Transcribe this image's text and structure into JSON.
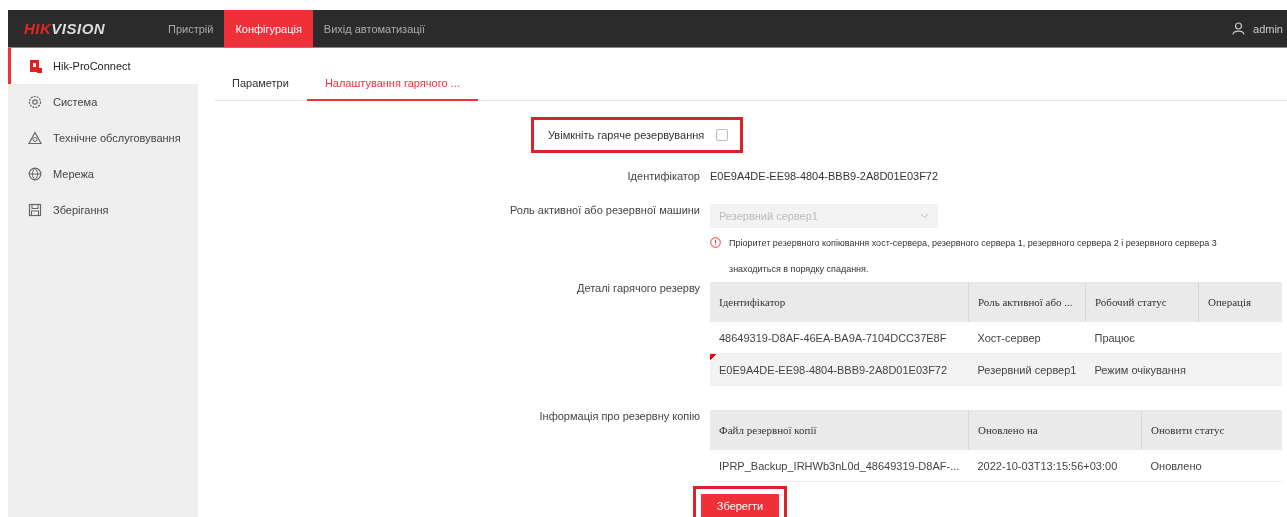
{
  "header": {
    "logo": {
      "red": "HIK",
      "dark": "VISION"
    },
    "nav": [
      {
        "label": "Пристрій",
        "selected": false
      },
      {
        "label": "Конфігурація",
        "selected": true
      },
      {
        "label": "Вихід автоматизації",
        "selected": false
      }
    ],
    "user": "admin"
  },
  "sidebar": {
    "items": [
      {
        "label": "Hik-ProConnect",
        "selected": true
      },
      {
        "label": "Система",
        "selected": false
      },
      {
        "label": "Технічне обслуговування",
        "selected": false
      },
      {
        "label": "Мережа",
        "selected": false
      },
      {
        "label": "Зберігання",
        "selected": false
      }
    ]
  },
  "tabs": [
    {
      "label": "Параметри",
      "selected": false
    },
    {
      "label": "Налаштування гарячого ...",
      "selected": true
    }
  ],
  "form": {
    "hot_standby": {
      "label": "Увімкніть гаряче резервування",
      "checked": false,
      "highlighted": true
    },
    "identifier": {
      "label": "Ідентифікатор",
      "value": "E0E9A4DE-EE98-4804-BBB9-2A8D01E03F72"
    },
    "role": {
      "label": "Роль активної або резервної машини",
      "value": "Резервний сервер1",
      "disabled": true,
      "hint": "Пріоритет резервного копіювання хост-сервера, резервного сервера 1, резервного сервера 2 і резервного сервера 3 знаходиться в порядку спадання."
    },
    "details": {
      "label": "Деталі гарячого резерву",
      "columns": [
        "Ідентифікатор",
        "Роль активної або ...",
        "Робочий статус",
        "Операція"
      ],
      "rows": [
        {
          "cells": [
            "48649319-D8AF-46EA-BA9A-7104DCC37E8F",
            "Хост-сервер",
            "Працює"
          ],
          "current": false
        },
        {
          "cells": [
            "E0E9A4DE-EE98-4804-BBB9-2A8D01E03F72",
            "Резервний сервер1",
            "Режим очікування"
          ],
          "current": true
        }
      ]
    },
    "backup": {
      "label": "Інформація про резервну копію",
      "columns": [
        "Файл резервної копії",
        "Оновлено на",
        "Оновити статус"
      ],
      "rows": [
        {
          "cells": [
            "IPRP_Backup_IRHWb3nL0d_48649319-D8AF-...",
            "2022-10-03T13:15:56+03:00",
            "Оновлено"
          ]
        }
      ]
    },
    "save": {
      "label": "Зберегти",
      "highlighted": true
    }
  }
}
